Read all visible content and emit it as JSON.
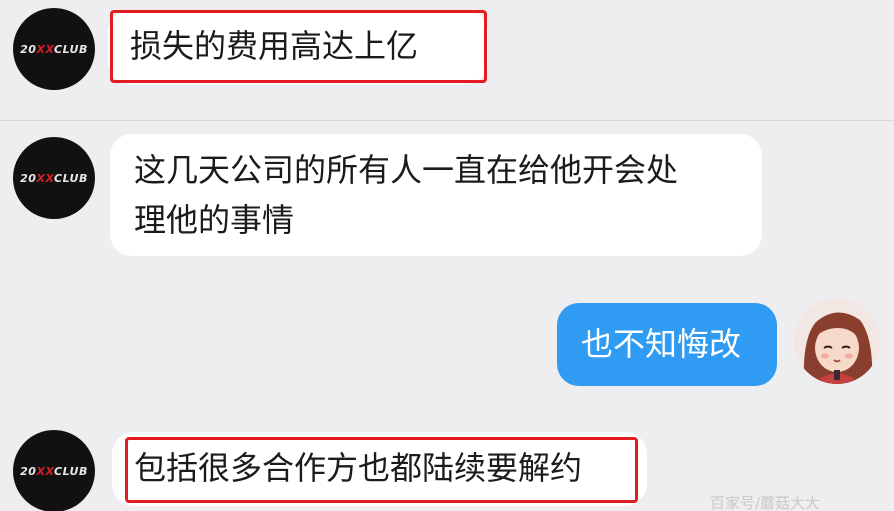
{
  "colors": {
    "background": "#eeeef1",
    "incoming_bubble": "#ffffff",
    "outgoing_bubble": "#2f9bf2",
    "highlight_border": "#e21d22"
  },
  "avatar_logo": {
    "left": "20",
    "accent": "XX",
    "right": "CLUB"
  },
  "messages": [
    {
      "direction": "incoming",
      "text": "损失的费用高达上亿",
      "highlighted": true
    },
    {
      "direction": "incoming",
      "lines": [
        "这几天公司的所有人一直在给他开会处",
        "理他的事情"
      ],
      "highlighted": false
    },
    {
      "direction": "outgoing",
      "text": "也不知悔改",
      "highlighted": false
    },
    {
      "direction": "incoming",
      "text": "包括很多合作方也都陆续要解约",
      "highlighted": true
    }
  ],
  "watermark": "百家号/蘑菇大大"
}
